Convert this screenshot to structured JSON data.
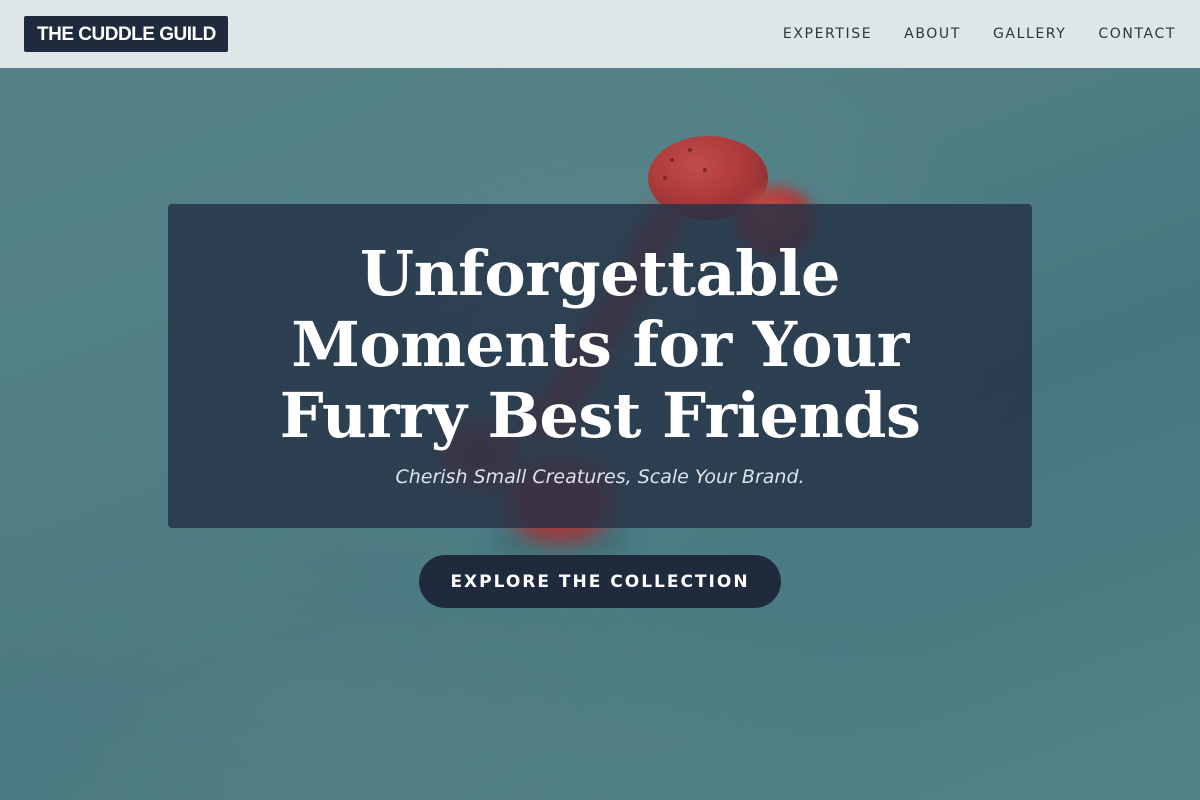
{
  "header": {
    "logo_text": "THE CUDDLE GUILD",
    "nav": [
      {
        "label": "EXPERTISE"
      },
      {
        "label": "ABOUT"
      },
      {
        "label": "GALLERY"
      },
      {
        "label": "CONTACT"
      }
    ]
  },
  "hero": {
    "title": "Unforgettable Moments for Your Furry Best Friends",
    "subtitle": "Cherish Small Creatures, Scale Your Brand.",
    "cta_label": "EXPLORE THE COLLECTION"
  },
  "colors": {
    "header_bg": "#dfe6e8",
    "logo_bg": "#1f2a3d",
    "card_bg": "#253245",
    "cta_bg": "#1f2a3d",
    "background_teal": "#5a8a90",
    "toy_red": "#c8413f"
  }
}
